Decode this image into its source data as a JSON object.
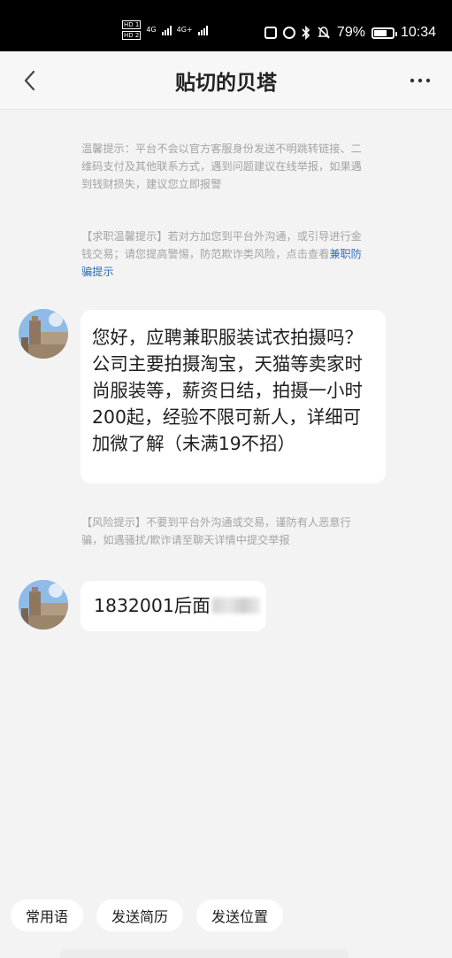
{
  "status_bar": {
    "sim1": "HD 1",
    "sim2": "HD 2",
    "network1": "4G",
    "network2": "4G+",
    "battery": "79%",
    "battery_level": 0.79,
    "time": "10:34",
    "icons": [
      "nfc-icon",
      "alarm-icon",
      "bluetooth-icon",
      "mute-icon",
      "battery-icon"
    ]
  },
  "header": {
    "title": "贴切的贝塔",
    "back_icon": "chevron-left-icon",
    "more_icon": "more-icon"
  },
  "notices": {
    "warm_tip": "温馨提示：平台不会以官方客服身份发送不明跳转链接、二维码支付及其他联系方式，遇到问题建议在线举报，如果遇到钱财损失，建议您立即报警",
    "job_tip": "【求职温馨提示】若对方加您到平台外沟通，或引导进行金钱交易；请您提高警惕，防范欺诈类风险，点击查看",
    "job_tip_link": "兼职防骗提示",
    "risk_tip": "【风险提示】不要到平台外沟通或交易，谨防有人恶意行骗，如遇骚扰/欺诈请至聊天详情中提交举报"
  },
  "messages": [
    {
      "text": "您好，应聘兼职服装试衣拍摄吗？公司主要拍摄淘宝，天猫等卖家时尚服装等，薪资日结，拍摄一小时200起，经验不限可新人，详细可加微了解（未满19不招）"
    },
    {
      "text": "1832001后面"
    }
  ],
  "quick_actions": [
    "常用语",
    "发送简历",
    "发送位置"
  ],
  "colors": {
    "background": "#f3f3f3",
    "notice_text": "#a4a4a4",
    "link": "#2f6dbd",
    "bubble": "#ffffff"
  }
}
